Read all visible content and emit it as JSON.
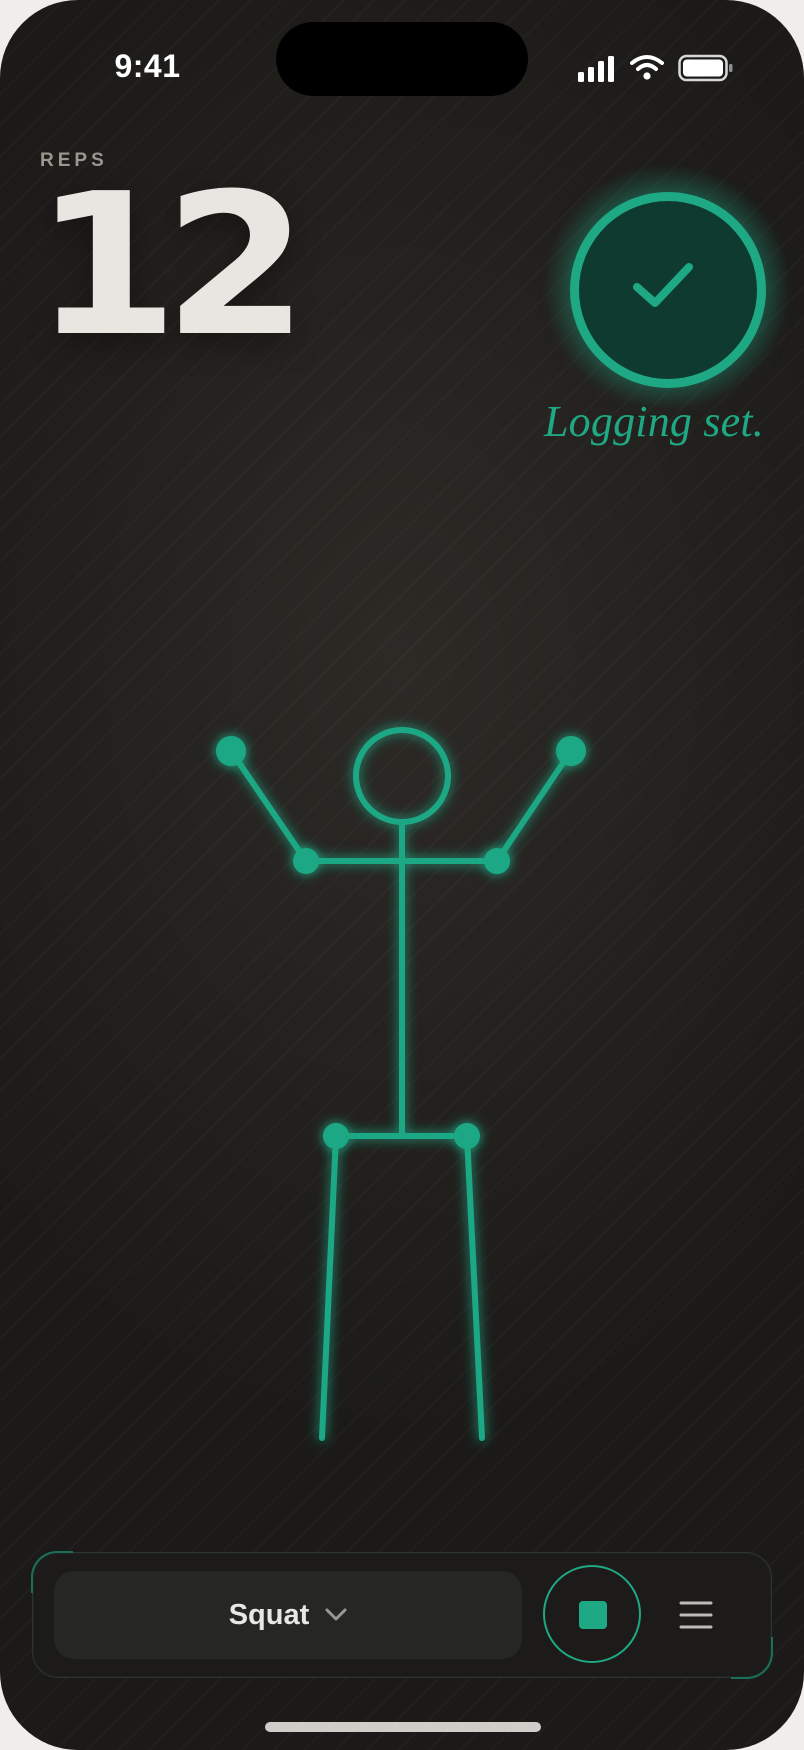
{
  "status_bar": {
    "time": "9:41"
  },
  "reps": {
    "label": "REPS",
    "count": "12"
  },
  "set_status": {
    "message": "Logging set."
  },
  "bottom_bar": {
    "exercise": "Squat",
    "stop_label": "",
    "menu_label": ""
  },
  "colors": {
    "accent": "#1ea884",
    "background": "#23211e",
    "text": "#e8e6e1"
  },
  "icons": [
    "signal-icon",
    "wifi-icon",
    "battery-icon",
    "checkmark-icon",
    "chevron-down-icon",
    "stop-icon",
    "menu-icon"
  ]
}
